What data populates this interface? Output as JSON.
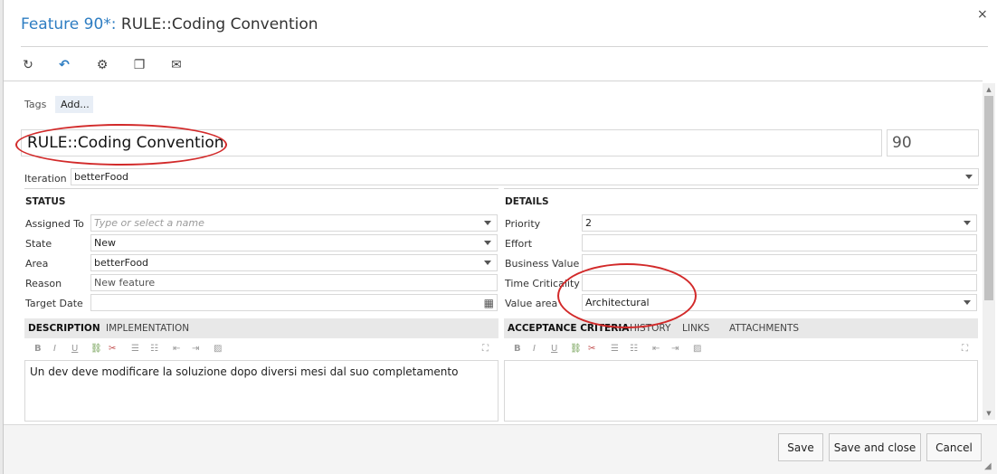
{
  "dialog": {
    "title_label": "Feature 90*:",
    "title_name": "RULE::Coding Convention",
    "close_glyph": "×"
  },
  "toolbar": {
    "refresh_glyph": "↻",
    "undo_glyph": "↶",
    "actions_glyph": "⚙",
    "copy_glyph": "❐",
    "email_glyph": "✉"
  },
  "tags": {
    "label": "Tags",
    "add_label": "Add..."
  },
  "item": {
    "title": "RULE::Coding Convention",
    "id": "90"
  },
  "iteration": {
    "label": "Iteration",
    "value": "betterFood"
  },
  "status": {
    "heading": "STATUS",
    "assigned_to": {
      "label": "Assigned To",
      "placeholder": "Type or select a name"
    },
    "state": {
      "label": "State",
      "value": "New"
    },
    "area": {
      "label": "Area",
      "value": "betterFood"
    },
    "reason": {
      "label": "Reason",
      "value": "New feature"
    },
    "target_date": {
      "label": "Target Date",
      "value": ""
    }
  },
  "details": {
    "heading": "DETAILS",
    "priority": {
      "label": "Priority",
      "value": "2"
    },
    "effort": {
      "label": "Effort",
      "value": ""
    },
    "business_value": {
      "label": "Business Value",
      "value": ""
    },
    "time_criticality": {
      "label": "Time Criticality",
      "value": ""
    },
    "value_area": {
      "label": "Value area",
      "value": "Architectural"
    }
  },
  "left_tabs": {
    "description": "DESCRIPTION",
    "implementation": "IMPLEMENTATION"
  },
  "right_tabs": {
    "acceptance": "ACCEPTANCE CRITERIA",
    "history": "HISTORY",
    "links": "LINKS",
    "attachments": "ATTACHMENTS"
  },
  "format": {
    "bold": "B",
    "italic": "I",
    "underline": "U",
    "indent": "⇥",
    "outdent": "⇤",
    "bullets": "☰",
    "numbers": "☷",
    "image": "▨",
    "maximize": "⛶",
    "link": "⛓",
    "unlink": "✂"
  },
  "description_text": "Un dev deve modificare la soluzione dopo diversi mesi dal suo completamento",
  "footer": {
    "save": "Save",
    "save_close": "Save and close",
    "cancel": "Cancel"
  },
  "colors": {
    "accent": "#2e7dc2",
    "annotation": "#d22a2a"
  }
}
